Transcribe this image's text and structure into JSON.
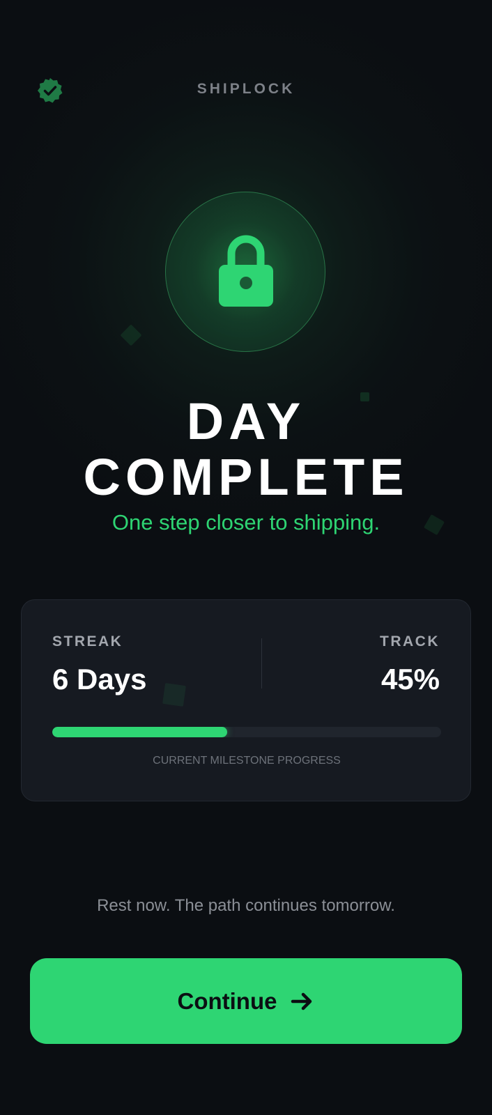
{
  "header": {
    "brand": "SHIPLOCK",
    "badge_icon": "verified-badge-icon"
  },
  "hero": {
    "icon": "lock-icon",
    "title_line1": "DAY",
    "title_line2": "COMPLETE",
    "subtitle": "One step closer to shipping."
  },
  "stats": {
    "streak_label": "STREAK",
    "streak_value": "6 Days",
    "track_label": "TRACK",
    "track_value": "45%",
    "progress": 0.45,
    "progress_caption": "CURRENT MILESTONE PROGRESS"
  },
  "footer": {
    "rest_message": "Rest now. The path continues tomorrow.",
    "continue_label": "Continue",
    "continue_icon": "arrow-right-icon"
  },
  "colors": {
    "background": "#0b0e12",
    "accent": "#2ed573",
    "card": "#161a21",
    "muted_text": "#8b8f96"
  }
}
